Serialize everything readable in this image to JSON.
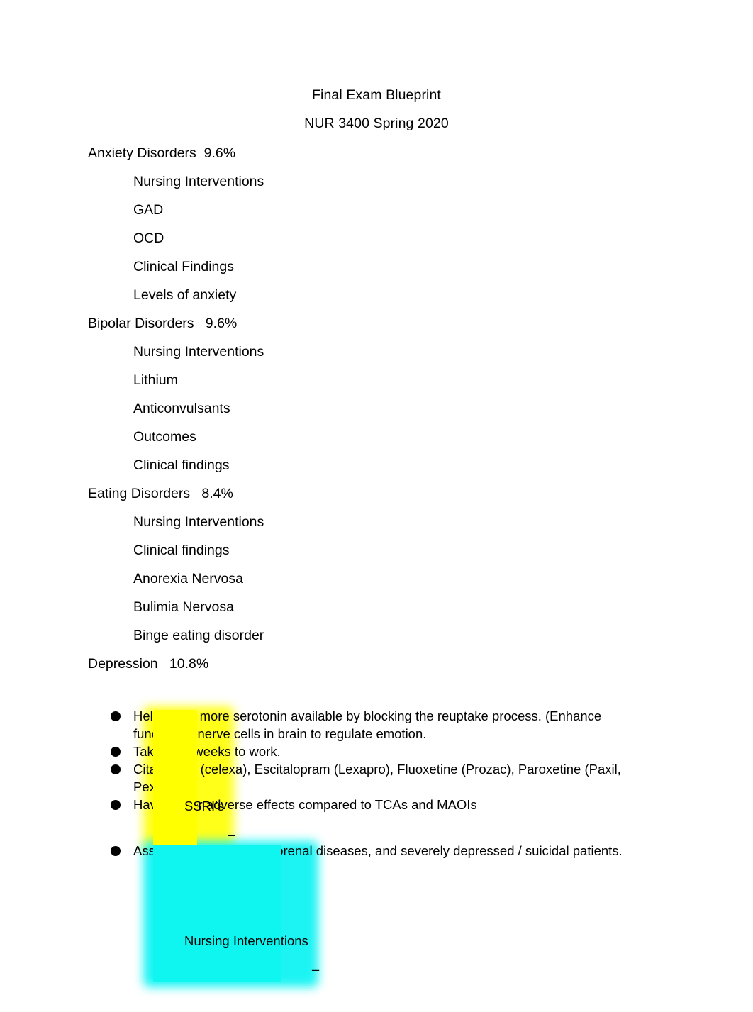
{
  "document": {
    "title_line_1": "Final Exam Blueprint",
    "title_line_2": "NUR 3400 Spring 2020"
  },
  "outline": [
    {
      "level": 1,
      "text": "Anxiety Disorders  9.6%"
    },
    {
      "level": 2,
      "text": "Nursing Interventions"
    },
    {
      "level": 2,
      "text": "GAD"
    },
    {
      "level": 2,
      "text": "OCD"
    },
    {
      "level": 2,
      "text": "Clinical Findings"
    },
    {
      "level": 2,
      "text": "Levels of anxiety"
    },
    {
      "level": 1,
      "text": "Bipolar Disorders   9.6%"
    },
    {
      "level": 2,
      "text": "Nursing Interventions"
    },
    {
      "level": 2,
      "text": "Lithium"
    },
    {
      "level": 2,
      "text": "Anticonvulsants"
    },
    {
      "level": 2,
      "text": "Outcomes"
    },
    {
      "level": 2,
      "text": "Clinical findings"
    },
    {
      "level": 1,
      "text": "Eating Disorders   8.4%"
    },
    {
      "level": 2,
      "text": "Nursing Interventions"
    },
    {
      "level": 2,
      "text": "Clinical findings"
    },
    {
      "level": 2,
      "text": "Anorexia Nervosa"
    },
    {
      "level": 2,
      "text": "Bulimia Nervosa"
    },
    {
      "level": 2,
      "text": "Binge eating disorder"
    },
    {
      "level": 1,
      "text": "Depression   10.8%"
    }
  ],
  "depression_detail": {
    "ssri_heading": {
      "label": "SSRI’s",
      "dash": " –",
      "highlight_color": "#ffff00"
    },
    "ssri_bullets": [
      "Help make more serotonin available by blocking the reuptake process. (Enhance function of nerve cells in brain to regulate emotion.",
      "Takes 4-6 weeks to work.",
      "Citalopram (celexa), Escitalopram (Lexapro), Fluoxetine (Prozac), Paroxetine (Paxil, Pexera).",
      "Have lesser adverse effects compared to TCAs and MAOIs"
    ],
    "nursing_heading": {
      "label": "Nursing Interventions",
      "dash": " –",
      "highlight_color": "#00ffff"
    },
    "nursing_bullets": [
      "Assess for allergy, hepatorenal diseases, and severely depressed / suicidal patients."
    ]
  }
}
